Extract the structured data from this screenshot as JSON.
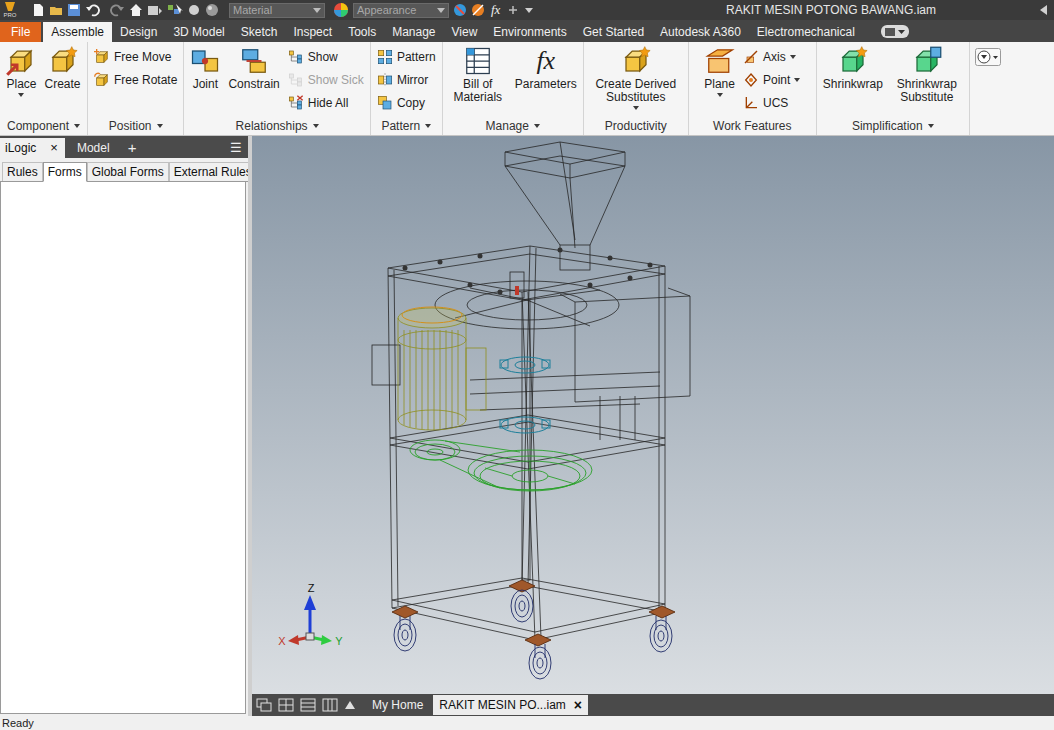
{
  "window": {
    "title": "RAKIT MESIN POTONG BAWANG.iam"
  },
  "app_badge": "PRO",
  "quick_access": {
    "material": "Material",
    "appearance": "Appearance",
    "fx": "fx"
  },
  "application_menu": {
    "label": "File"
  },
  "ribbon_tabs": [
    {
      "label": "Assemble",
      "selected": true
    },
    {
      "label": "Design",
      "selected": false
    },
    {
      "label": "3D Model",
      "selected": false
    },
    {
      "label": "Sketch",
      "selected": false
    },
    {
      "label": "Inspect",
      "selected": false
    },
    {
      "label": "Tools",
      "selected": false
    },
    {
      "label": "Manage",
      "selected": false
    },
    {
      "label": "View",
      "selected": false
    },
    {
      "label": "Environments",
      "selected": false
    },
    {
      "label": "Get Started",
      "selected": false
    },
    {
      "label": "Autodesk A360",
      "selected": false
    },
    {
      "label": "Electromechanical",
      "selected": false
    }
  ],
  "ribbon_groups": [
    {
      "label": "Component",
      "dropdown": true,
      "columns": [
        {
          "kind": "large",
          "tools": [
            {
              "label": "Place",
              "dropdown": true,
              "disabled": false
            }
          ]
        },
        {
          "kind": "large",
          "tools": [
            {
              "label": "Create",
              "dropdown": false,
              "disabled": false
            }
          ]
        }
      ]
    },
    {
      "label": "Position",
      "dropdown": true,
      "columns": [
        {
          "kind": "stack",
          "tools": [
            {
              "label": "Free Move",
              "dropdown": false,
              "disabled": false
            },
            {
              "label": "Free Rotate",
              "dropdown": false,
              "disabled": false
            }
          ]
        }
      ]
    },
    {
      "label": "Relationships",
      "dropdown": true,
      "columns": [
        {
          "kind": "large",
          "tools": [
            {
              "label": "Joint",
              "dropdown": false,
              "disabled": false
            }
          ]
        },
        {
          "kind": "large",
          "tools": [
            {
              "label": "Constrain",
              "dropdown": false,
              "disabled": false
            }
          ]
        },
        {
          "kind": "stack",
          "tools": [
            {
              "label": "Show",
              "dropdown": false,
              "disabled": false
            },
            {
              "label": "Show Sick",
              "dropdown": false,
              "disabled": true
            },
            {
              "label": "Hide All",
              "dropdown": false,
              "disabled": false
            }
          ]
        }
      ]
    },
    {
      "label": "Pattern",
      "dropdown": true,
      "columns": [
        {
          "kind": "stack",
          "tools": [
            {
              "label": "Pattern",
              "dropdown": false,
              "disabled": false
            },
            {
              "label": "Mirror",
              "dropdown": false,
              "disabled": false
            },
            {
              "label": "Copy",
              "dropdown": false,
              "disabled": false
            }
          ]
        }
      ]
    },
    {
      "label": "Manage",
      "dropdown": true,
      "columns": [
        {
          "kind": "large",
          "tools": [
            {
              "label": "Bill of Materials",
              "dropdown": false,
              "disabled": false
            }
          ]
        },
        {
          "kind": "large",
          "tools": [
            {
              "label": "Parameters",
              "dropdown": false,
              "disabled": false,
              "glyph": "fx"
            }
          ]
        }
      ]
    },
    {
      "label": "Productivity",
      "dropdown": false,
      "columns": [
        {
          "kind": "large",
          "tools": [
            {
              "label": "Create Derived Substitutes",
              "dropdown": true,
              "disabled": false
            }
          ]
        }
      ]
    },
    {
      "label": "Work Features",
      "dropdown": false,
      "columns": [
        {
          "kind": "large",
          "tools": [
            {
              "label": "Plane",
              "dropdown": true,
              "disabled": false
            }
          ]
        },
        {
          "kind": "stack",
          "tools": [
            {
              "label": "Axis",
              "dropdown": true,
              "disabled": false
            },
            {
              "label": "Point",
              "dropdown": true,
              "disabled": false
            },
            {
              "label": "UCS",
              "dropdown": false,
              "disabled": false
            }
          ]
        }
      ]
    },
    {
      "label": "Simplification",
      "dropdown": true,
      "columns": [
        {
          "kind": "large",
          "tools": [
            {
              "label": "Shrinkwrap",
              "dropdown": false,
              "disabled": false
            }
          ]
        },
        {
          "kind": "large",
          "tools": [
            {
              "label": "Shrinkwrap Substitute",
              "dropdown": false,
              "disabled": false
            }
          ]
        }
      ]
    }
  ],
  "panel_tabs": [
    {
      "label": "iLogic",
      "selected": true,
      "close": "×"
    },
    {
      "label": "Model",
      "selected": false
    }
  ],
  "panel_add": "+",
  "panel_menu": "☰",
  "panel_subtabs": [
    {
      "label": "Rules",
      "selected": false
    },
    {
      "label": "Forms",
      "selected": true
    },
    {
      "label": "Global Forms",
      "selected": false
    },
    {
      "label": "External Rules",
      "selected": false
    }
  ],
  "view_triad": {
    "x": "X",
    "y": "Y",
    "z": "Z"
  },
  "document_tabs": [
    {
      "label": "My Home",
      "selected": false
    },
    {
      "label": "RAKIT MESIN PO...iam",
      "selected": true,
      "close": "×"
    }
  ],
  "status_bar": {
    "text": "Ready"
  }
}
